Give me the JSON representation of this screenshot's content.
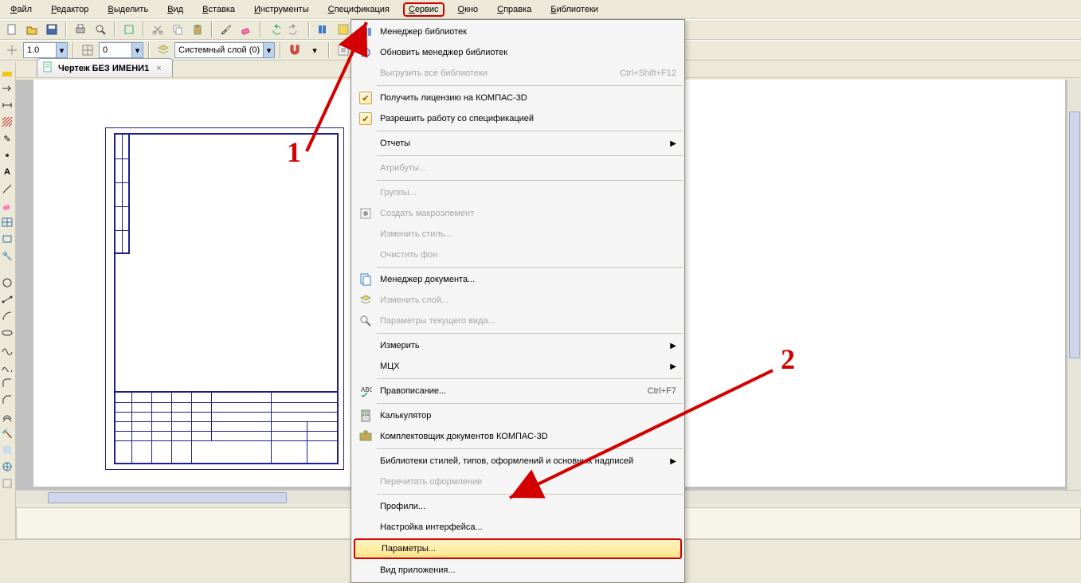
{
  "menubar": [
    "Файл",
    "Редактор",
    "Выделить",
    "Вид",
    "Вставка",
    "Инструменты",
    "Спецификация",
    "Сервис",
    "Окно",
    "Справка",
    "Библиотеки"
  ],
  "menubar_highlight_index": 7,
  "toolbar1": {
    "scale_value": "1.0",
    "step_value": "0",
    "layer_value": "Системный слой (0)"
  },
  "tab": {
    "title": "Чертеж БЕЗ ИМЕНИ1"
  },
  "dropdown": {
    "items": [
      {
        "type": "item",
        "label": "Менеджер библиотек",
        "icon": "library-manager-icon"
      },
      {
        "type": "item",
        "label": "Обновить менеджер библиотек",
        "icon": "refresh-icon"
      },
      {
        "type": "item",
        "label": "Выгрузить все библиотеки",
        "shortcut": "Ctrl+Shift+F12",
        "disabled": true
      },
      {
        "type": "sep"
      },
      {
        "type": "item",
        "label": "Получить лицензию на КОМПАС-3D",
        "check": true,
        "underline": "К"
      },
      {
        "type": "item",
        "label": "Разрешить работу со спецификацией",
        "check": true
      },
      {
        "type": "sep"
      },
      {
        "type": "item",
        "label": "Отчеты",
        "sub": true
      },
      {
        "type": "sep"
      },
      {
        "type": "item",
        "label": "Атрибуты...",
        "disabled": true
      },
      {
        "type": "sep"
      },
      {
        "type": "item",
        "label": "Группы...",
        "disabled": true
      },
      {
        "type": "item",
        "label": "Создать макроэлемент",
        "icon": "macro-icon",
        "disabled": true
      },
      {
        "type": "item",
        "label": "Изменить стиль...",
        "disabled": true
      },
      {
        "type": "item",
        "label": "Очистить фон",
        "disabled": true
      },
      {
        "type": "sep"
      },
      {
        "type": "item",
        "label": "Менеджер документа...",
        "icon": "doc-manager-icon"
      },
      {
        "type": "item",
        "label": "Изменить слой...",
        "icon": "layer-icon",
        "disabled": true
      },
      {
        "type": "item",
        "label": "Параметры текущего вида...",
        "icon": "view-params-icon",
        "disabled": true
      },
      {
        "type": "sep"
      },
      {
        "type": "item",
        "label": "Измерить",
        "sub": true
      },
      {
        "type": "item",
        "label": "МЦХ",
        "sub": true
      },
      {
        "type": "sep"
      },
      {
        "type": "item",
        "label": "Правописание...",
        "icon": "spell-icon",
        "shortcut": "Ctrl+F7"
      },
      {
        "type": "sep"
      },
      {
        "type": "item",
        "label": "Калькулятор",
        "icon": "calc-icon"
      },
      {
        "type": "item",
        "label": "Комплектовщик документов КОМПАС-3D",
        "icon": "bundle-icon"
      },
      {
        "type": "sep"
      },
      {
        "type": "item",
        "label": "Библиотеки стилей, типов, оформлений и основных надписей",
        "sub": true
      },
      {
        "type": "item",
        "label": "Перечитать оформление",
        "disabled": true
      },
      {
        "type": "sep"
      },
      {
        "type": "item",
        "label": "Профили..."
      },
      {
        "type": "item",
        "label": "Настройка интерфейса..."
      },
      {
        "type": "item",
        "label": "Параметры...",
        "highlighted": true
      },
      {
        "type": "item",
        "label": "Вид приложения..."
      }
    ]
  },
  "annotations": {
    "marker1": "1",
    "marker2": "2"
  }
}
